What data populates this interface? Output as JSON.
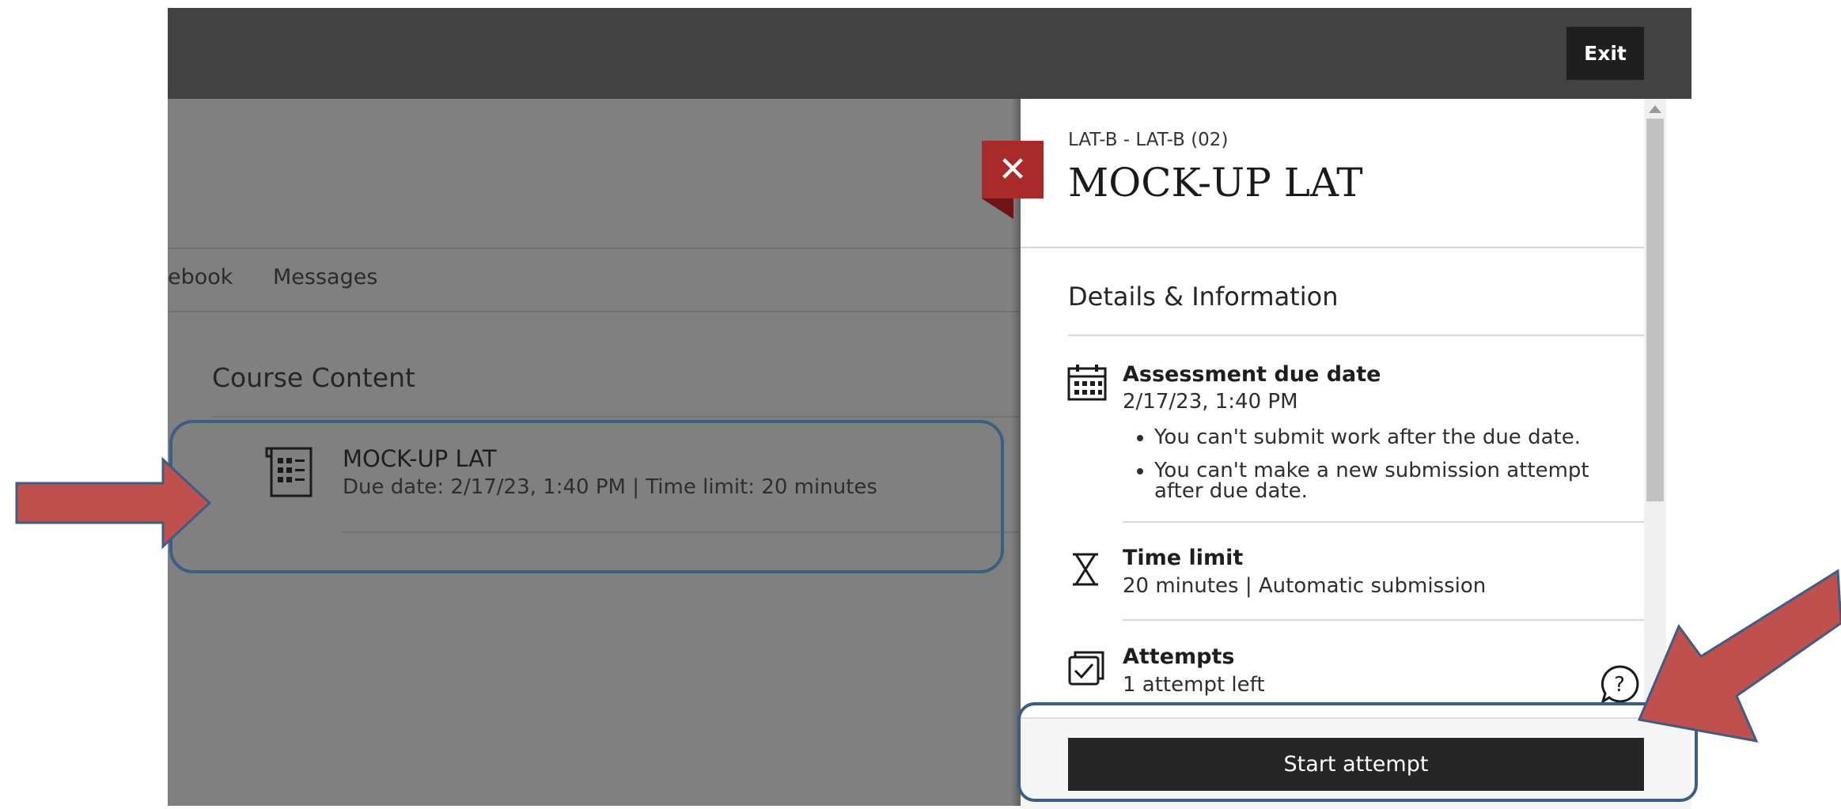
{
  "header": {
    "exit_label": "Exit"
  },
  "course_nav": {
    "items": [
      "ebook",
      "Messages"
    ]
  },
  "course_content": {
    "heading": "Course Content",
    "item": {
      "title": "MOCK-UP LAT",
      "meta": "Due date: 2/17/23, 1:40 PM  |  Time limit: 20 minutes",
      "icon": "assessment-icon"
    }
  },
  "panel": {
    "close_icon": "close-icon",
    "breadcrumb": "LAT-B - LAT-B (02)",
    "title": "MOCK-UP LAT",
    "details_heading": "Details & Information",
    "due": {
      "icon": "calendar-icon",
      "title": "Assessment due date",
      "value": "2/17/23, 1:40 PM",
      "bullets": [
        "You can't submit work after the due date.",
        "You can't make a new submission attempt after due date."
      ]
    },
    "time_limit": {
      "icon": "hourglass-icon",
      "title": "Time limit",
      "value": "20 minutes | Automatic submission"
    },
    "attempts": {
      "icon": "attempts-icon",
      "title": "Attempts",
      "value": "1 attempt left"
    },
    "help_icon": "help-icon",
    "start_label": "Start attempt"
  },
  "colors": {
    "close_button": "#a92a2a",
    "annotation_arrow": "#c0504d",
    "annotation_outline": "#3e5d84",
    "start_button": "#262626"
  }
}
